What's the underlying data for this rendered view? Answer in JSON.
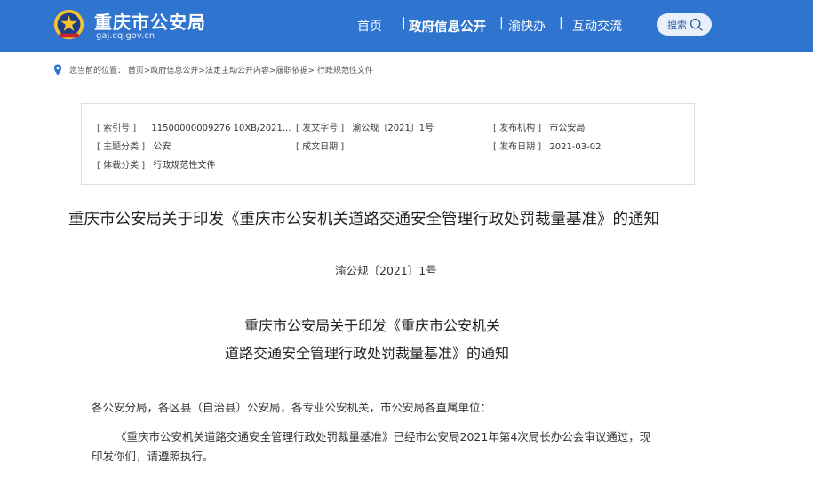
{
  "header": {
    "site_name": "重庆市公安局",
    "site_domain": "gaj.cq.gov.cn",
    "nav": {
      "home": "首页",
      "sep1": "|",
      "gov_info": "政府信息公开",
      "sep2": "|",
      "yukuaiban": "渝快办",
      "sep3": "|",
      "interaction": "互动交流"
    },
    "search_label": "搜索"
  },
  "breadcrumb": {
    "text": "您当前的位置： 首页>政府信息公开>法定主动公开内容>履职依据> 行政规范性文件"
  },
  "info": {
    "index_label": "[ 索引号 ]",
    "index_value": "11500000009276 10XB/2021...",
    "doc_no_label": "[ 发文字号 ]",
    "doc_no_value": "渝公规〔2021〕1号",
    "issuer_label": "[ 发布机构 ]",
    "issuer_value": "市公安局",
    "topic_label": "[ 主题分类 ]",
    "topic_value": "公安",
    "created_label": "[ 成文日期 ]",
    "created_value": "",
    "published_label": "[ 发布日期 ]",
    "published_value": "2021-03-02",
    "genre_label": "[ 体裁分类 ]",
    "genre_value": "行政规范性文件"
  },
  "article": {
    "title": "重庆市公安局关于印发《重庆市公安机关道路交通安全管理行政处罚裁量基准》的通知",
    "doc_number": "渝公规〔2021〕1号",
    "subtitle_line1": "重庆市公安局关于印发《重庆市公安机关",
    "subtitle_line2": "道路交通安全管理行政处罚裁量基准》的通知",
    "addressee": "各公安分局，各区县（自治县）公安局，各专业公安机关，市公安局各直属单位：",
    "body_line1": "《重庆市公安机关道路交通安全管理行政处罚裁量基准》已经市公安局2021年第4次局长办公会审议通过，现",
    "body_line2": "印发你们，请遵照执行。"
  },
  "colors": {
    "header_bg": "#2f74cf",
    "search_bg": "#e8f0fb"
  },
  "icons": {
    "emblem": "police-emblem-icon",
    "search": "search-icon",
    "location": "location-pin-icon"
  }
}
